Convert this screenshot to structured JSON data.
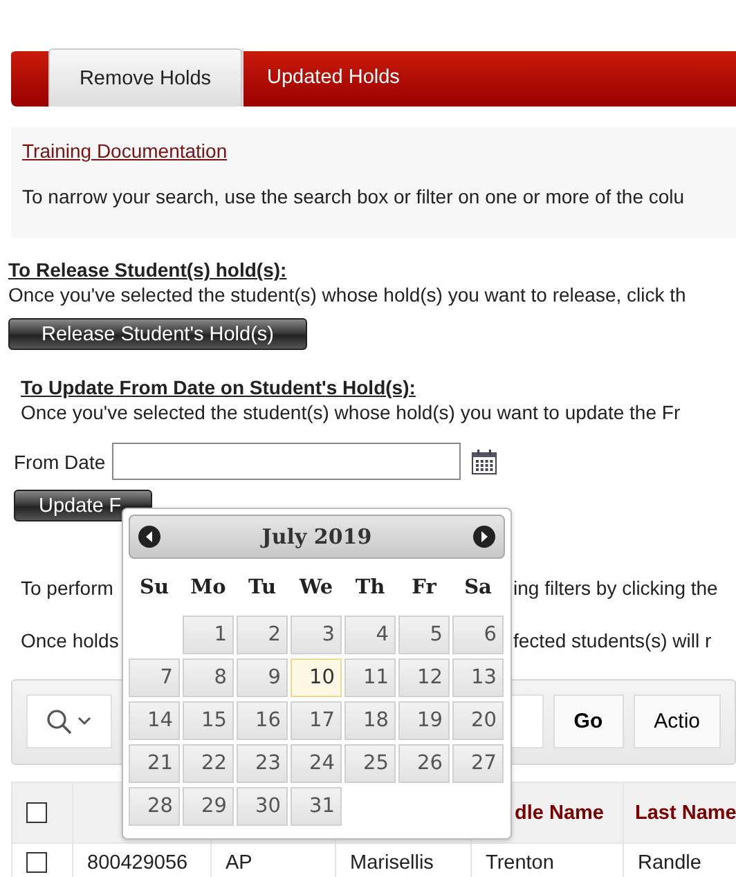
{
  "tabs": [
    {
      "label": "Remove Holds",
      "selected": true
    },
    {
      "label": "Updated Holds",
      "selected": false
    }
  ],
  "info_panel": {
    "link": "Training Documentation",
    "text": "To narrow your search, use the search box or filter on one or more of the colu"
  },
  "release_section": {
    "heading": "To Release Student(s) hold(s):",
    "text": "Once you've selected the student(s) whose hold(s) you want to release, click th",
    "button": "Release Student's Hold(s)"
  },
  "update_section": {
    "heading": "To Update From Date on Student's Hold(s):",
    "text": "Once you've selected the student(s) whose hold(s) you want to update the Fr",
    "from_date_label": "From Date",
    "button": "Update F"
  },
  "notes": [
    {
      "left": "To perform",
      "right": "ing filters by clicking the"
    },
    {
      "left": "Once holds",
      "right": "fected students(s) will r"
    }
  ],
  "datepicker": {
    "title": "July 2019",
    "weekdays": [
      "Su",
      "Mo",
      "Tu",
      "We",
      "Th",
      "Fr",
      "Sa"
    ],
    "weeks": [
      [
        {
          "label": "1",
          "today": false
        },
        {
          "label": "2",
          "today": false
        },
        {
          "label": "3",
          "today": false
        },
        {
          "label": "4",
          "today": false
        },
        {
          "label": "5",
          "today": false
        },
        {
          "label": "6",
          "today": false
        }
      ],
      [
        {
          "label": "7",
          "today": false
        },
        {
          "label": "8",
          "today": false
        },
        {
          "label": "9",
          "today": false
        },
        {
          "label": "10",
          "today": true
        },
        {
          "label": "11",
          "today": false
        },
        {
          "label": "12",
          "today": false
        },
        {
          "label": "13",
          "today": false
        }
      ],
      [
        {
          "label": "14",
          "today": false
        },
        {
          "label": "15",
          "today": false
        },
        {
          "label": "16",
          "today": false
        },
        {
          "label": "17",
          "today": false
        },
        {
          "label": "18",
          "today": false
        },
        {
          "label": "19",
          "today": false
        },
        {
          "label": "20",
          "today": false
        }
      ],
      [
        {
          "label": "21",
          "today": false
        },
        {
          "label": "22",
          "today": false
        },
        {
          "label": "23",
          "today": false
        },
        {
          "label": "24",
          "today": false
        },
        {
          "label": "25",
          "today": false
        },
        {
          "label": "26",
          "today": false
        },
        {
          "label": "27",
          "today": false
        }
      ],
      [
        {
          "label": "28",
          "today": false
        },
        {
          "label": "29",
          "today": false
        },
        {
          "label": "30",
          "today": false
        },
        {
          "label": "31",
          "today": false
        }
      ]
    ]
  },
  "toolbar": {
    "go_button": "Go",
    "actions_button": "Actio"
  },
  "table": {
    "header_checked": false,
    "columns": [
      {},
      {},
      {},
      {
        "label": "dle Name"
      },
      {
        "label": "Last Name"
      }
    ],
    "rows": [
      {
        "checked": false,
        "cells": [
          "800429056",
          "AP",
          "Marisellis",
          "Trenton",
          "Randle"
        ]
      }
    ]
  }
}
